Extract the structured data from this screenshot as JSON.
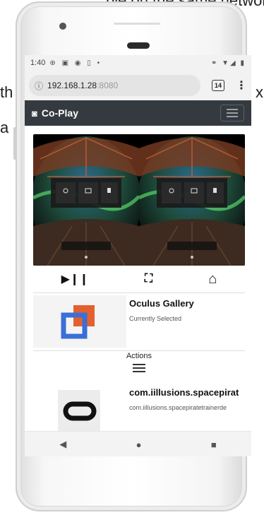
{
  "background": {
    "top_text": "ble on the same network",
    "left_text_1": "th",
    "left_text_2": "a",
    "right_text": "x"
  },
  "statusbar": {
    "time": "1:40"
  },
  "browser": {
    "url_host": "192.168.1.28",
    "url_port": ":8080",
    "tab_count": "14"
  },
  "app": {
    "brand": "Co-Play"
  },
  "controls": {
    "play_pause": "▶❙❙",
    "fullscreen": "⛶",
    "home": "⌂"
  },
  "items": [
    {
      "title": "Oculus Gallery",
      "subtitle": "Currently Selected"
    },
    {
      "title": "com.iillusions.spacepirat",
      "subtitle": "com.iillusions.spacepiratetrainerde"
    }
  ],
  "actions": {
    "label": "Actions"
  },
  "colors": {
    "appbar": "#343a40",
    "gallery_blue": "#3a6fd6",
    "gallery_orange": "#e5602f"
  }
}
